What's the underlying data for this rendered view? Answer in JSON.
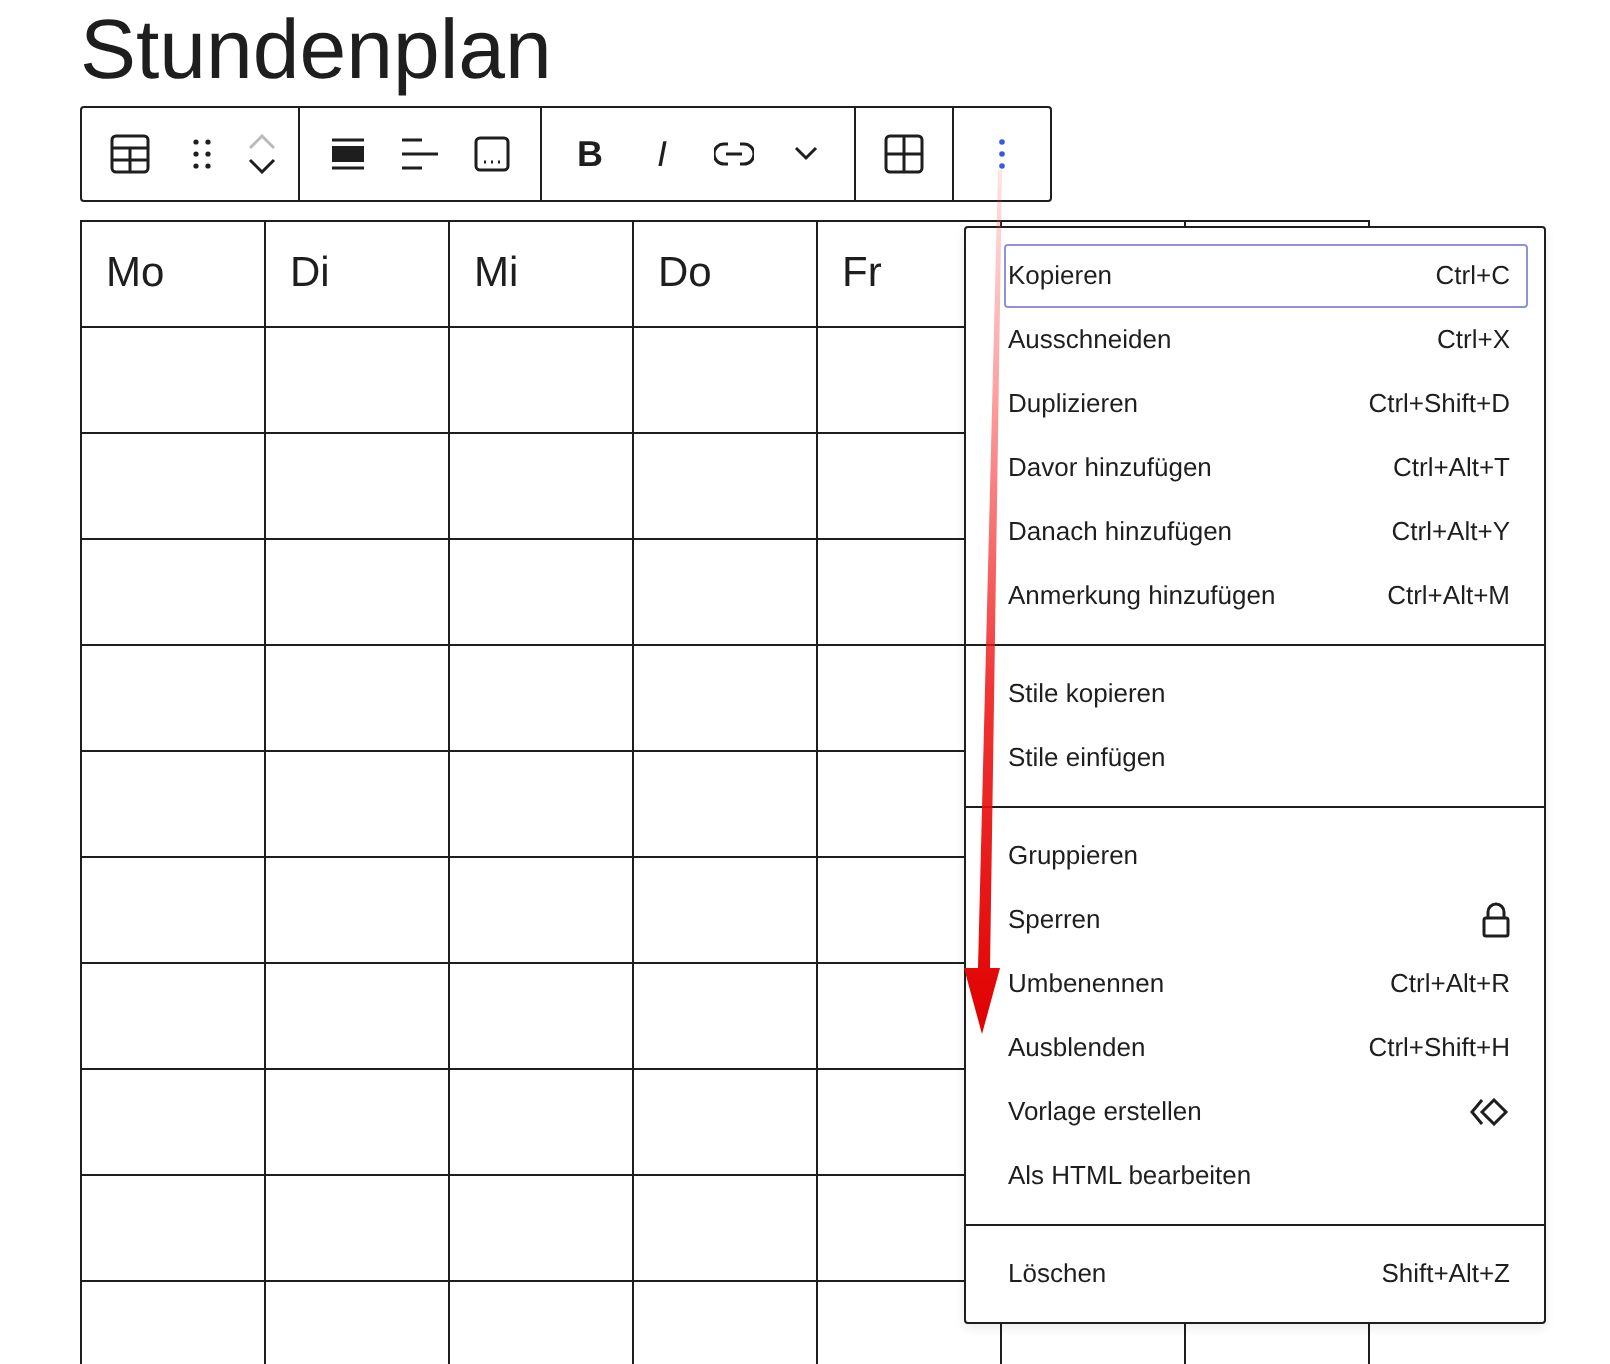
{
  "title": "Stundenplan",
  "toolbar": {
    "bold_label": "B",
    "italic_label": "I"
  },
  "table": {
    "columns": [
      "Mo",
      "Di",
      "Mi",
      "Do",
      "Fr"
    ]
  },
  "menu": {
    "sections": [
      [
        {
          "label": "Kopieren",
          "kind": "shortcut",
          "shortcut": "Ctrl+C",
          "selected": true
        },
        {
          "label": "Ausschneiden",
          "kind": "shortcut",
          "shortcut": "Ctrl+X",
          "selected": false
        },
        {
          "label": "Duplizieren",
          "kind": "shortcut",
          "shortcut": "Ctrl+Shift+D",
          "selected": false
        },
        {
          "label": "Davor hinzufügen",
          "kind": "shortcut",
          "shortcut": "Ctrl+Alt+T",
          "selected": false
        },
        {
          "label": "Danach hinzufügen",
          "kind": "shortcut",
          "shortcut": "Ctrl+Alt+Y",
          "selected": false
        },
        {
          "label": "Anmerkung hinzufügen",
          "kind": "shortcut",
          "shortcut": "Ctrl+Alt+M",
          "selected": false
        }
      ],
      [
        {
          "label": "Stile kopieren",
          "kind": "plain",
          "selected": false
        },
        {
          "label": "Stile einfügen",
          "kind": "plain",
          "selected": false
        }
      ],
      [
        {
          "label": "Gruppieren",
          "kind": "plain",
          "selected": false
        },
        {
          "label": "Sperren",
          "kind": "lock",
          "selected": false
        },
        {
          "label": "Umbenennen",
          "kind": "shortcut",
          "shortcut": "Ctrl+Alt+R",
          "selected": false
        },
        {
          "label": "Ausblenden",
          "kind": "shortcut",
          "shortcut": "Ctrl+Shift+H",
          "selected": false
        },
        {
          "label": "Vorlage erstellen",
          "kind": "pattern",
          "selected": false
        },
        {
          "label": "Als HTML bearbeiten",
          "kind": "plain",
          "selected": false
        }
      ],
      [
        {
          "label": "Löschen",
          "kind": "shortcut",
          "shortcut": "Shift+Alt+Z",
          "selected": false
        }
      ]
    ]
  }
}
